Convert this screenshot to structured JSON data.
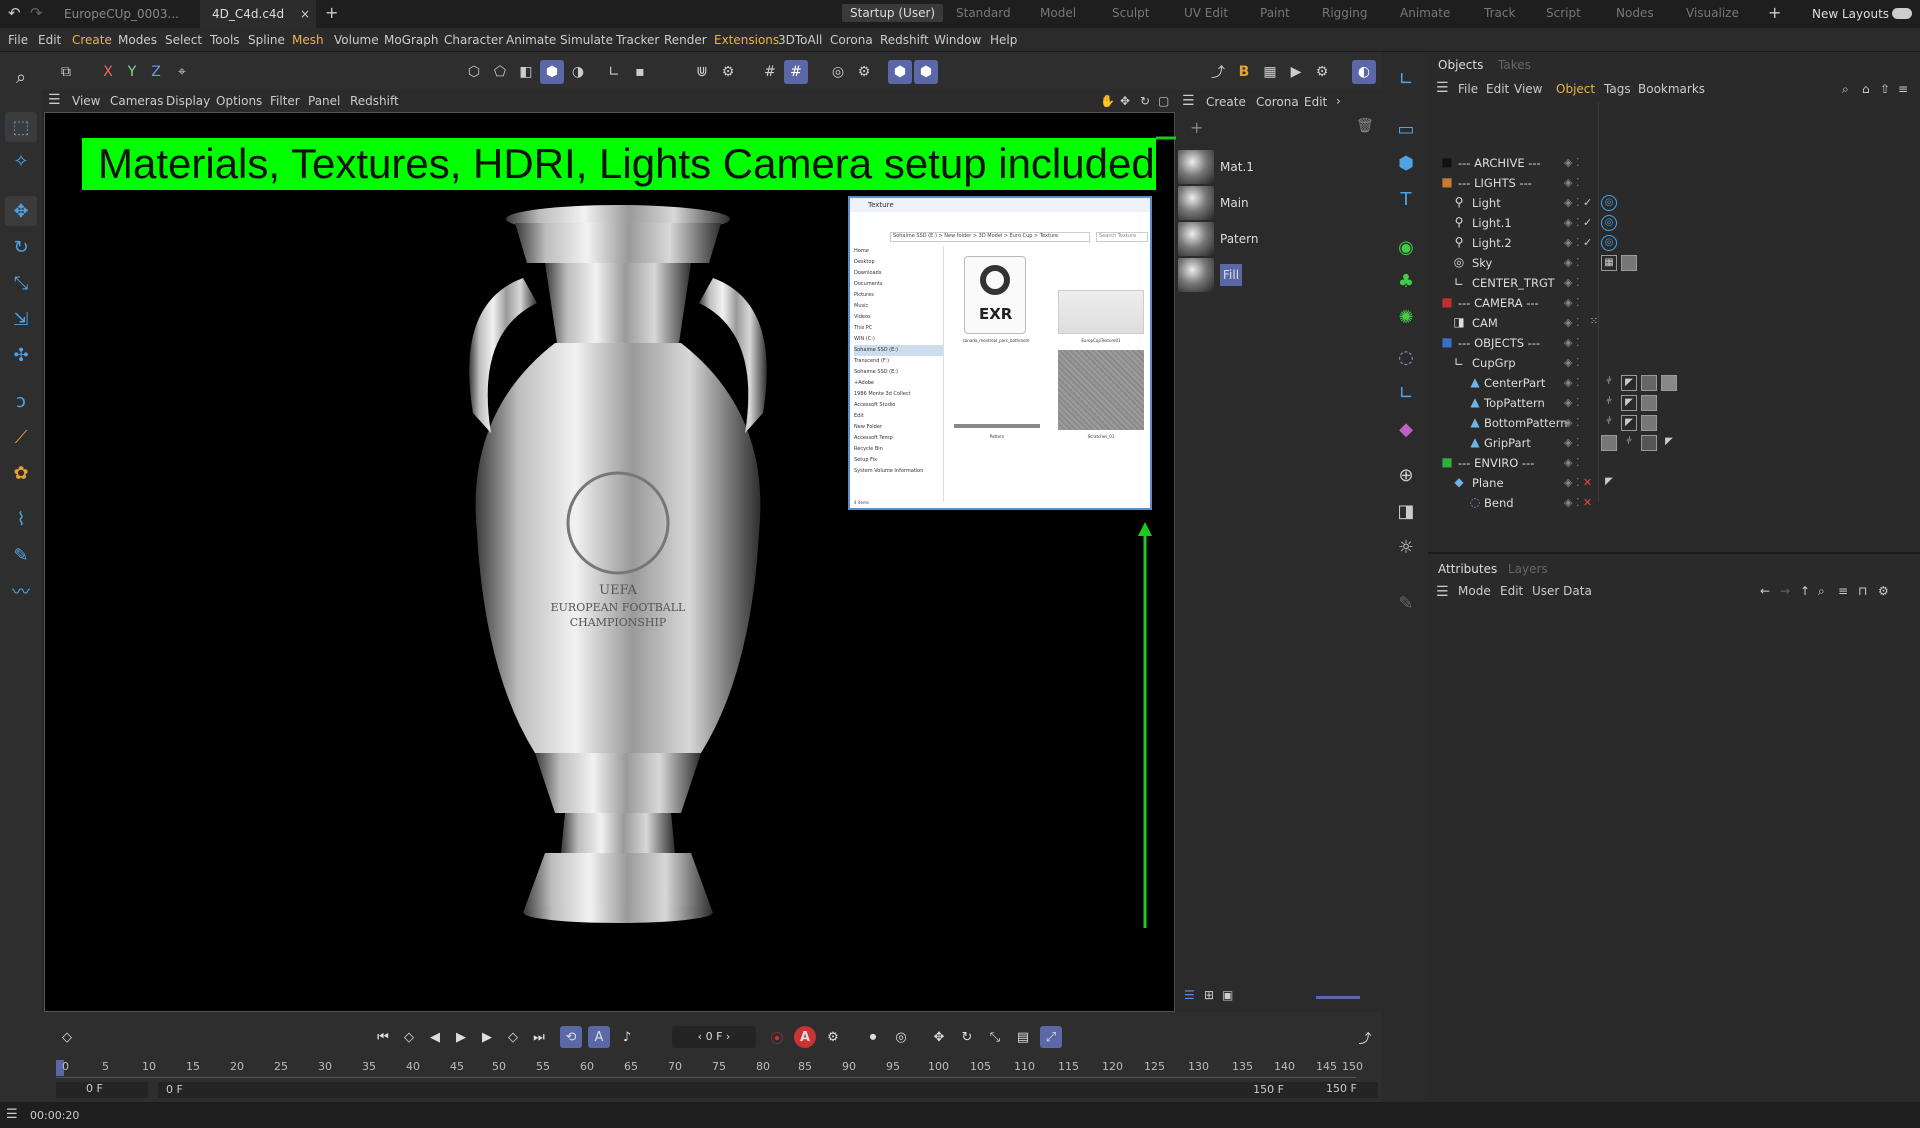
{
  "tabs": {
    "doc1": "EuropeCUp_0003...",
    "doc2": "4D_C4d.c4d",
    "doc2_close": "×",
    "new_tab": "+"
  },
  "layouts": [
    "Startup (User)",
    "Standard",
    "Model",
    "Sculpt",
    "UV Edit",
    "Paint",
    "Rigging",
    "Animate",
    "Track",
    "Script",
    "Nodes",
    "Visualize"
  ],
  "layout_add": "+",
  "new_layouts": "New Layouts",
  "menu": [
    "File",
    "Edit",
    "Create",
    "Modes",
    "Select",
    "Tools",
    "Spline",
    "Mesh",
    "Volume",
    "MoGraph",
    "Character",
    "Animate",
    "Simulate",
    "Tracker",
    "Render",
    "Extensions",
    "3DToAll",
    "Corona",
    "Redshift",
    "Window",
    "Help"
  ],
  "axes": {
    "x": "X",
    "y": "Y",
    "z": "Z"
  },
  "viewport_menu": [
    "View",
    "Cameras",
    "Display",
    "Options",
    "Filter",
    "Panel",
    "Redshift"
  ],
  "banner": "Materials, Textures, HDRI, Lights Camera setup included",
  "trophy": {
    "line1": "UEFA",
    "line2": "EUROPEAN FOOTBALL",
    "line3": "CHAMPIONSHIP"
  },
  "explorer": {
    "title": "Texture",
    "address": "Sohaime SSD (E:) > New folder > 3D Model > Euro Cup > Texture",
    "search": "Search Texture",
    "exr_label": "EXR",
    "file1": "canada_montreal_parc_bathroom",
    "file2": "EuropCupTexture01",
    "file3": "Pattern",
    "file4": "Scratches_01",
    "nav": [
      "Home",
      "Desktop",
      "Downloads",
      "Documents",
      "Pictures",
      "Music",
      "Videos",
      "This PC",
      "WIN (C:)",
      "Sohaime SSD (E:)",
      "Transcend (F:)",
      "Sohaime SSD (E:)",
      "+Adobe",
      "1986 Monte 3d Collect",
      "Accessoft Studio",
      "Edit",
      "New Folder",
      "Accessoft Temp",
      "Recycle Bin",
      "Setup Fix",
      "System Volume Information"
    ],
    "status": "4 items"
  },
  "mat_menu": [
    "Create",
    "Corona",
    "Edit"
  ],
  "materials": [
    "Mat.1",
    "Main",
    "Patern",
    "Fill"
  ],
  "obj_tabs": {
    "objects": "Objects",
    "takes": "Takes"
  },
  "obj_menu": [
    "File",
    "Edit",
    "View",
    "Object",
    "Tags",
    "Bookmarks"
  ],
  "objects": [
    {
      "name": "--- ARCHIVE ---",
      "indent": 0,
      "icon": "■",
      "color": "#111"
    },
    {
      "name": "--- LIGHTS ---",
      "indent": 0,
      "icon": "■",
      "color": "#c87a30"
    },
    {
      "name": "Light",
      "indent": 1,
      "icon": "💡",
      "color": "#ddd"
    },
    {
      "name": "Light.1",
      "indent": 1,
      "icon": "💡",
      "color": "#ddd"
    },
    {
      "name": "Light.2",
      "indent": 1,
      "icon": "💡",
      "color": "#ddd"
    },
    {
      "name": "Sky",
      "indent": 1,
      "icon": "◎",
      "color": "#ddd"
    },
    {
      "name": "CENTER_TRGT",
      "indent": 1,
      "icon": "∟",
      "color": "#ddd"
    },
    {
      "name": "--- CAMERA ---",
      "indent": 0,
      "icon": "■",
      "color": "#c03030"
    },
    {
      "name": "CAM",
      "indent": 1,
      "icon": "▭",
      "color": "#ddd"
    },
    {
      "name": "--- OBJECTS ---",
      "indent": 0,
      "icon": "■",
      "color": "#3a6fc8"
    },
    {
      "name": "CupGrp",
      "indent": 1,
      "icon": "∟",
      "color": "#ddd"
    },
    {
      "name": "CenterPart",
      "indent": 2,
      "icon": "▲",
      "color": "#6ab4ea"
    },
    {
      "name": "TopPattern",
      "indent": 2,
      "icon": "▲",
      "color": "#6ab4ea"
    },
    {
      "name": "BottomPattern",
      "indent": 2,
      "icon": "▲",
      "color": "#6ab4ea"
    },
    {
      "name": "GripPart",
      "indent": 2,
      "icon": "▲",
      "color": "#6ab4ea"
    },
    {
      "name": "--- ENVIRO ---",
      "indent": 0,
      "icon": "■",
      "color": "#2fae3a"
    },
    {
      "name": "Plane",
      "indent": 1,
      "icon": "◆",
      "color": "#6ab4ea"
    },
    {
      "name": "Bend",
      "indent": 2,
      "icon": "◌",
      "color": "#9a8ae6"
    }
  ],
  "attr_tabs": {
    "attributes": "Attributes",
    "layers": "Layers"
  },
  "attr_menu": [
    "Mode",
    "Edit",
    "User Data"
  ],
  "timeline": {
    "frame": "0 F",
    "ticks": [
      "0",
      "5",
      "10",
      "15",
      "20",
      "25",
      "30",
      "35",
      "40",
      "45",
      "50",
      "55",
      "60",
      "65",
      "70",
      "75",
      "80",
      "85",
      "90",
      "95",
      "100",
      "105",
      "110",
      "115",
      "120",
      "125",
      "130",
      "135",
      "140",
      "145",
      "150"
    ],
    "start": "0 F",
    "preview_start": "0 F",
    "preview_end": "150 F",
    "end": "150 F"
  },
  "status_time": "00:00:20",
  "colors": {
    "accent_blue": "#5a68a8",
    "banner_green": "#00ff00",
    "arrow_green": "#1ec81e",
    "highlight": "#e8b44a"
  }
}
